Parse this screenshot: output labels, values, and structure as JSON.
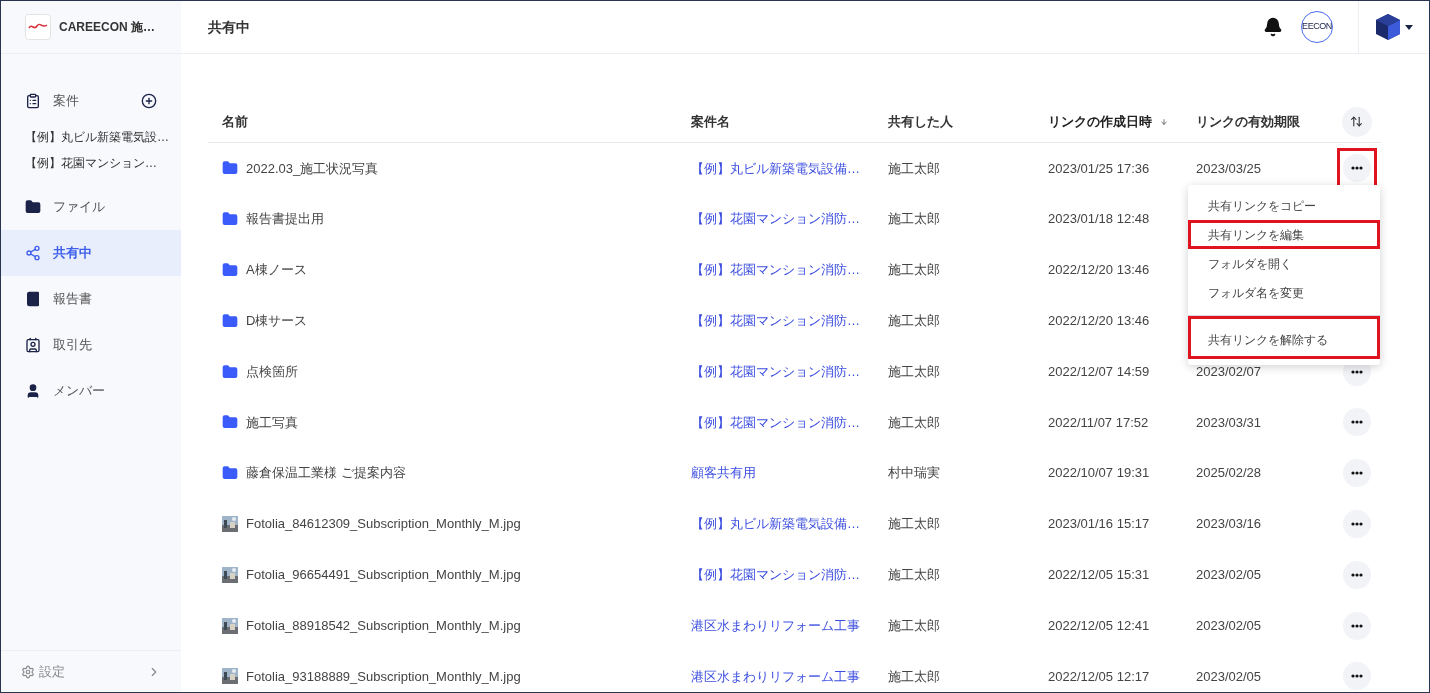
{
  "workspace": {
    "name": "CAREECON 施…"
  },
  "sidebar": {
    "items": [
      {
        "kind": "projects",
        "label": "案件",
        "selected": false,
        "children": [
          {
            "label": "【例】丸ビル新築電気設…"
          },
          {
            "label": "【例】花園マンション…"
          }
        ]
      },
      {
        "kind": "files",
        "label": "ファイル",
        "selected": false
      },
      {
        "kind": "shared",
        "label": "共有中",
        "selected": true
      },
      {
        "kind": "reports",
        "label": "報告書",
        "selected": false
      },
      {
        "kind": "clients",
        "label": "取引先",
        "selected": false
      },
      {
        "kind": "members",
        "label": "メンバー",
        "selected": false
      }
    ],
    "settings": "設定"
  },
  "header": {
    "title": "共有中",
    "account_badge": "EECON"
  },
  "table": {
    "columns": [
      {
        "label": "名前",
        "sorted": false
      },
      {
        "label": "案件名",
        "sorted": false
      },
      {
        "label": "共有した人",
        "sorted": false
      },
      {
        "label": "リンクの作成日時",
        "sorted": true
      },
      {
        "label": "リンクの有効期限",
        "sorted": false
      }
    ],
    "rows": [
      {
        "kind": "folder",
        "name": "2022.03_施工状況写真",
        "project": "【例】丸ビル新築電気設備…",
        "sharer": "施工太郎",
        "created": "2023/01/25 17:36",
        "expiry": "2023/03/25"
      },
      {
        "kind": "folder",
        "name": "報告書提出用",
        "project": "【例】花園マンション消防…",
        "sharer": "施工太郎",
        "created": "2023/01/18 12:48"
      },
      {
        "kind": "folder",
        "name": "A棟ノース",
        "project": "【例】花園マンション消防…",
        "sharer": "施工太郎",
        "created": "2022/12/20 13:46"
      },
      {
        "kind": "folder",
        "name": "D棟サース",
        "project": "【例】花園マンション消防…",
        "sharer": "施工太郎",
        "created": "2022/12/20 13:46"
      },
      {
        "kind": "folder",
        "name": "点検箇所",
        "project": "【例】花園マンション消防…",
        "sharer": "施工太郎",
        "created": "2022/12/07 14:59",
        "expiry": "2023/02/07"
      },
      {
        "kind": "folder",
        "name": "施工写真",
        "project": "【例】花園マンション消防…",
        "sharer": "施工太郎",
        "created": "2022/11/07 17:52",
        "expiry": "2023/03/31"
      },
      {
        "kind": "folder",
        "name": "藤倉保温工業様 ご提案内容",
        "project": "顧客共有用",
        "sharer": "村中瑞実",
        "created": "2022/10/07 19:31",
        "expiry": "2025/02/28"
      },
      {
        "name": "Fotolia_84612309_Subscription_Monthly_M.jpg",
        "project": "【例】丸ビル新築電気設備…",
        "sharer": "施工太郎",
        "created": "2023/01/16 15:17",
        "expiry": "2023/03/16"
      },
      {
        "name": "Fotolia_96654491_Subscription_Monthly_M.jpg",
        "project": "【例】花園マンション消防…",
        "sharer": "施工太郎",
        "created": "2022/12/05 15:31",
        "expiry": "2023/02/05"
      },
      {
        "name": "Fotolia_88918542_Subscription_Monthly_M.jpg",
        "project": "港区水まわりリフォーム工事",
        "sharer": "施工太郎",
        "created": "2022/12/05 12:41",
        "expiry": "2023/02/05"
      },
      {
        "name": "Fotolia_93188889_Subscription_Monthly_M.jpg",
        "project": "港区水まわりリフォーム工事",
        "sharer": "施工太郎",
        "created": "2022/12/05 12:17",
        "expiry": "2023/02/05"
      }
    ]
  },
  "context_menu": {
    "anchor_highlighted": true,
    "items": [
      {
        "label": "共有リンクをコピー",
        "highlighted": false,
        "divider_before": false
      },
      {
        "label": "共有リンクを編集",
        "highlighted": true,
        "divider_before": false
      },
      {
        "label": "フォルダを開く",
        "highlighted": false,
        "divider_before": false
      },
      {
        "label": "フォルダ名を変更",
        "highlighted": false,
        "divider_before": false
      },
      {
        "label": "共有リンクを解除する",
        "highlighted": true,
        "divider_before": true
      }
    ]
  }
}
